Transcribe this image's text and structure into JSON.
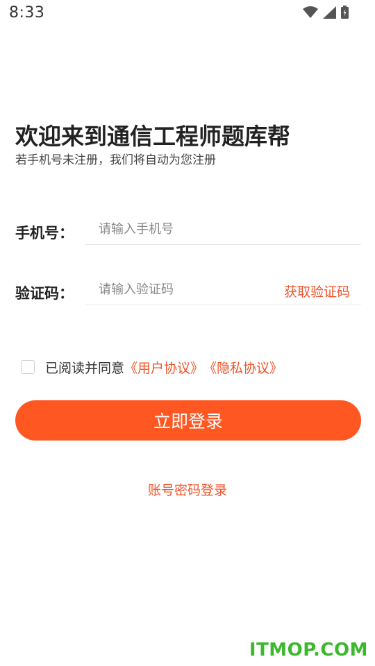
{
  "status_bar": {
    "time": "8:33",
    "icons": [
      "wifi-icon",
      "cellular-signal-icon",
      "battery-charging-icon"
    ]
  },
  "header": {
    "title": "欢迎来到通信工程师题库帮",
    "subtitle": "若手机号未注册，我们将自动为您注册"
  },
  "form": {
    "phone_label": "手机号：",
    "phone_placeholder": "请输入手机号",
    "phone_value": "",
    "code_label": "验证码：",
    "code_placeholder": "请输入验证码",
    "code_value": "",
    "get_code_label": "获取验证码"
  },
  "agreement": {
    "checked": false,
    "prefix": "已阅读并同意",
    "user_agreement": "《用户协议》",
    "privacy_agreement": "《隐私协议》"
  },
  "login_button": "立即登录",
  "account_login": "账号密码登录",
  "watermark": "ITMOP.COM",
  "colors": {
    "accent": "#ff5722",
    "link": "#f0542a",
    "watermark": "#3db82e"
  }
}
